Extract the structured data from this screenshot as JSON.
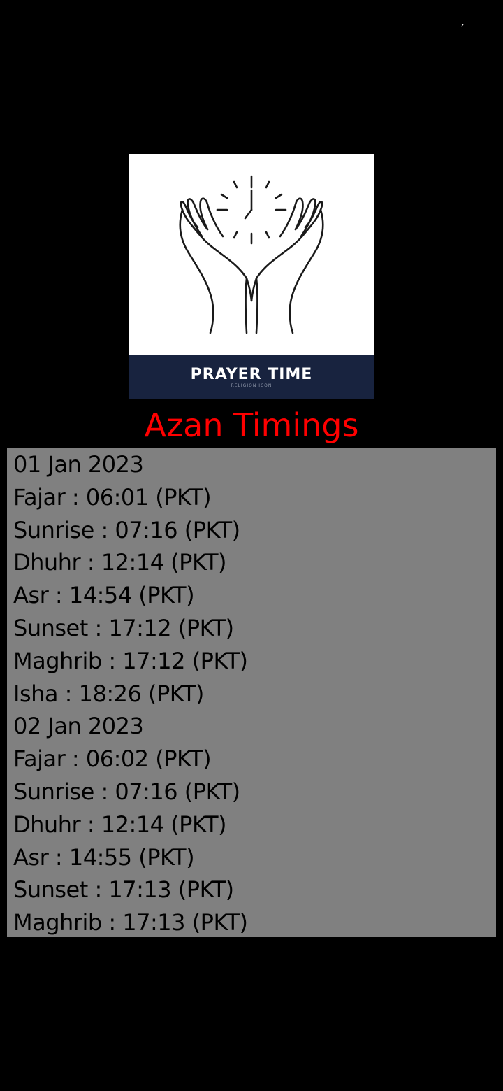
{
  "status_bar": {
    "mark": "ˏ"
  },
  "logo": {
    "title": "PRAYER TIME",
    "subtitle": "RELIGION ICON",
    "icon": "praying-hands-clock-icon",
    "colors": {
      "band": "#18233f",
      "background": "#ffffff",
      "lines": "#1a1a1a"
    }
  },
  "page": {
    "title": "Azan Timings",
    "title_color": "#ff0000",
    "box_color": "#808080"
  },
  "timings": [
    {
      "type": "date",
      "text": "01 Jan 2023"
    },
    {
      "type": "time",
      "text": "Fajar : 06:01 (PKT)"
    },
    {
      "type": "time",
      "text": "Sunrise : 07:16 (PKT)"
    },
    {
      "type": "time",
      "text": "Dhuhr : 12:14 (PKT)"
    },
    {
      "type": "time",
      "text": "Asr : 14:54 (PKT)"
    },
    {
      "type": "time",
      "text": "Sunset : 17:12 (PKT)"
    },
    {
      "type": "time",
      "text": "Maghrib : 17:12 (PKT)"
    },
    {
      "type": "time",
      "text": "Isha : 18:26 (PKT)"
    },
    {
      "type": "date",
      "text": "02 Jan 2023"
    },
    {
      "type": "time",
      "text": "Fajar : 06:02 (PKT)"
    },
    {
      "type": "time",
      "text": "Sunrise : 07:16 (PKT)"
    },
    {
      "type": "time",
      "text": "Dhuhr : 12:14 (PKT)"
    },
    {
      "type": "time",
      "text": "Asr : 14:55 (PKT)"
    },
    {
      "type": "time",
      "text": "Sunset : 17:13 (PKT)"
    },
    {
      "type": "time",
      "text": "Maghrib : 17:13 (PKT)"
    }
  ]
}
